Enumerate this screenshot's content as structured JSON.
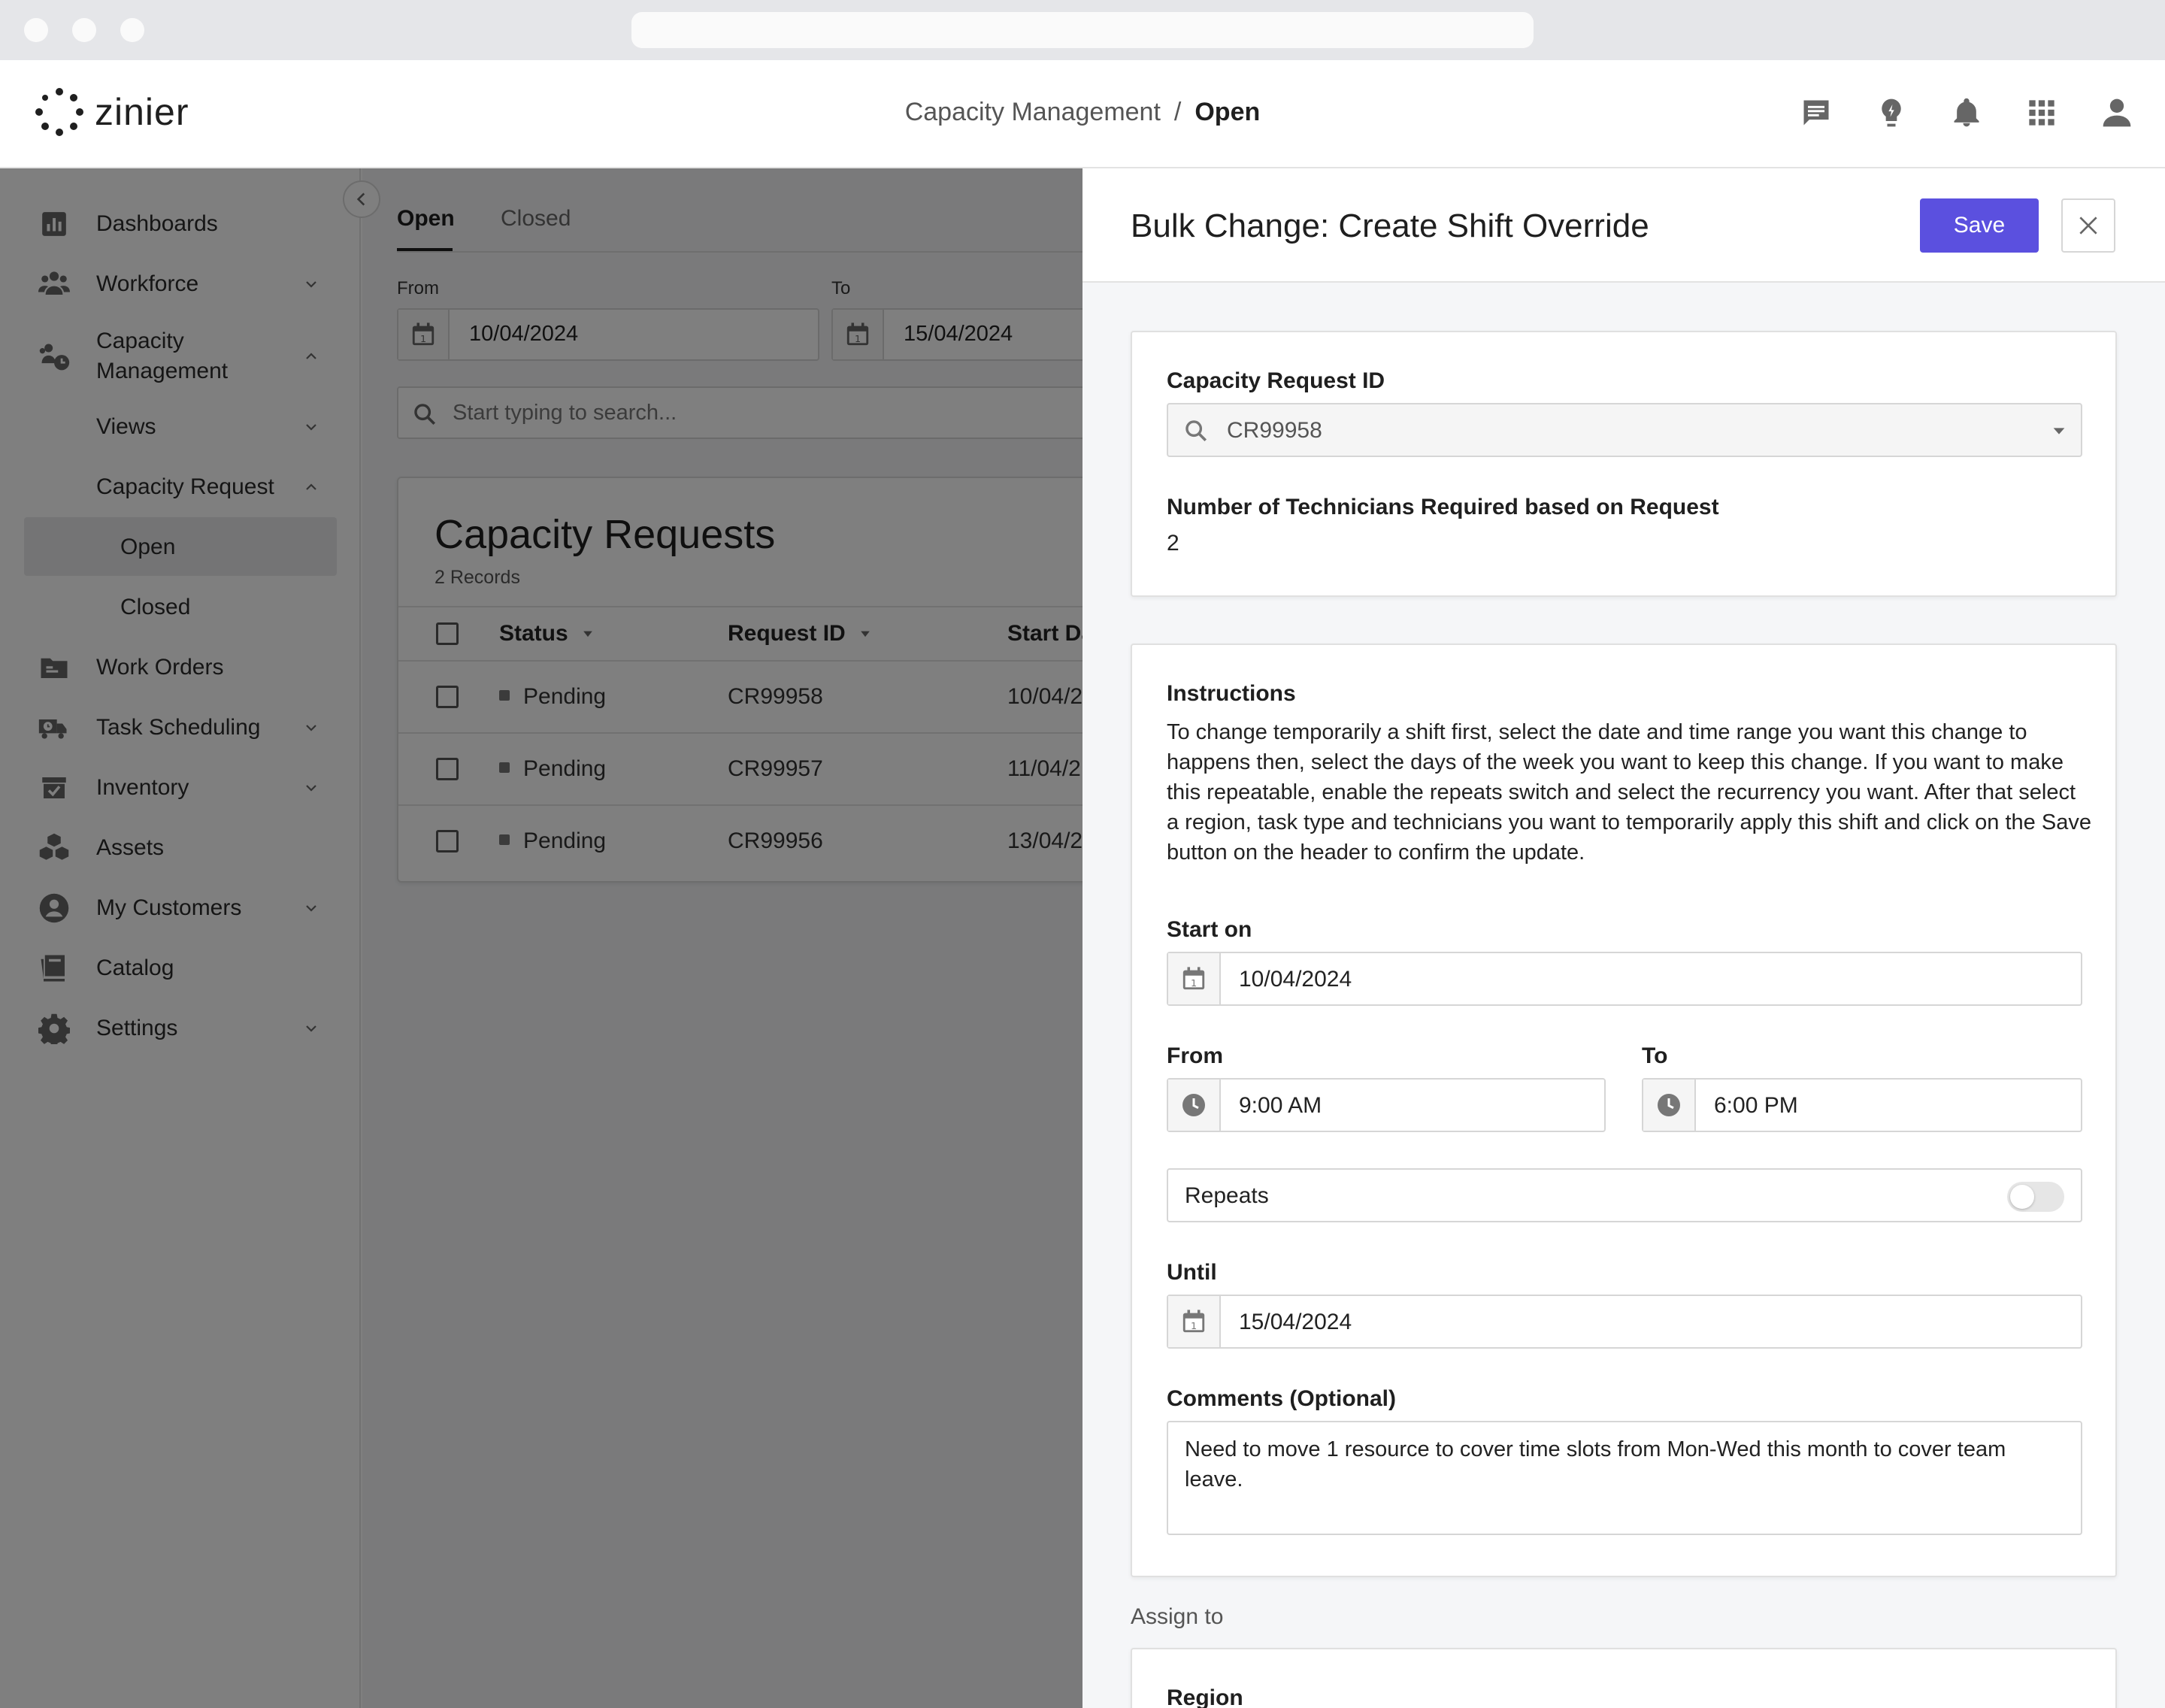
{
  "header": {
    "logo_text": "zinier",
    "breadcrumb_parent": "Capacity Management",
    "breadcrumb_separator": "/",
    "breadcrumb_current": "Open"
  },
  "sidebar": {
    "items": [
      {
        "label": "Dashboards"
      },
      {
        "label": "Workforce"
      },
      {
        "label": "Capacity Management"
      },
      {
        "label": "Views"
      },
      {
        "label": "Capacity Request"
      },
      {
        "label": "Open"
      },
      {
        "label": "Closed"
      },
      {
        "label": "Work Orders"
      },
      {
        "label": "Task Scheduling"
      },
      {
        "label": "Inventory"
      },
      {
        "label": "Assets"
      },
      {
        "label": "My Customers"
      },
      {
        "label": "Catalog"
      },
      {
        "label": "Settings"
      }
    ]
  },
  "main": {
    "tabs": [
      {
        "label": "Open"
      },
      {
        "label": "Closed"
      }
    ],
    "from_label": "From",
    "to_label": "To",
    "from_value": "10/04/2024",
    "to_value": "15/04/2024",
    "search_placeholder": "Start typing to search...",
    "card_title": "Capacity Requests",
    "card_subtitle": "2 Records",
    "columns": [
      "Status",
      "Request ID",
      "Start Da"
    ],
    "rows": [
      {
        "status": "Pending",
        "request_id": "CR99958",
        "start": "10/04/2"
      },
      {
        "status": "Pending",
        "request_id": "CR99957",
        "start": "11/04/2"
      },
      {
        "status": "Pending",
        "request_id": "CR99956",
        "start": "13/04/2"
      }
    ]
  },
  "drawer": {
    "title": "Bulk Change: Create Shift Override",
    "save_label": "Save",
    "capacity_request_label": "Capacity Request ID",
    "capacity_request_value": "CR99958",
    "technicians_label": "Number of Technicians Required based on Request",
    "technicians_value": "2",
    "instructions_label": "Instructions",
    "instructions_text": "To change temporarily a shift first, select the date and time range you want this change to happens then, select the days of the week you want to keep this change. If you want to make this repeatable, enable the repeats switch and select the recurrency you want. After that select a region, task type and technicians you want to temporarily apply this shift and click on the Save button on the header to confirm the update.",
    "start_on_label": "Start on",
    "start_on_value": "10/04/2024",
    "from_label": "From",
    "from_value": "9:00 AM",
    "to_label": "To",
    "to_value": "6:00 PM",
    "repeats_label": "Repeats",
    "repeats_on": false,
    "until_label": "Until",
    "until_value": "15/04/2024",
    "comments_label": "Comments (Optional)",
    "comments_value": "Need to move 1 resource to cover time slots from Mon-Wed this month to cover team leave.",
    "assign_to_label": "Assign to",
    "region_label": "Region"
  },
  "colors": {
    "primary": "#5b50df",
    "overlay": "rgba(0,0,0,0.5)"
  }
}
